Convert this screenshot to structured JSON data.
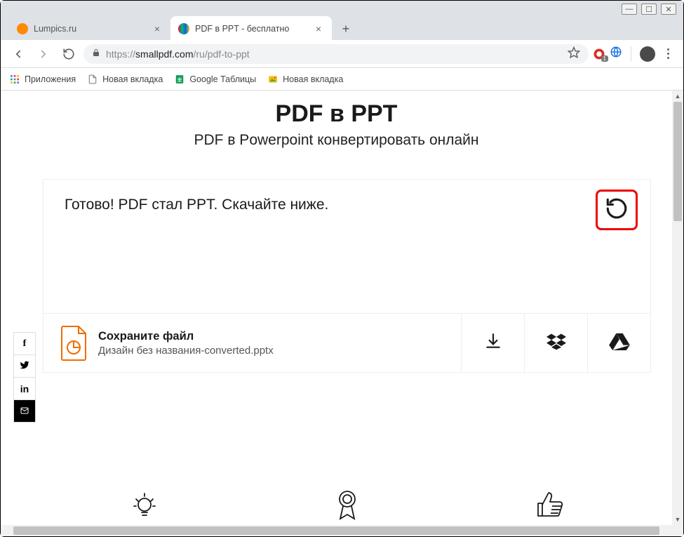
{
  "browser": {
    "tabs": [
      {
        "label": "Lumpics.ru",
        "favicon_color": "#ff8a00",
        "active": false
      },
      {
        "label": "PDF в PPT - бесплатно",
        "favicon_stripes": true,
        "active": true
      }
    ],
    "url": {
      "scheme": "https://",
      "host": "smallpdf.com",
      "path": "/ru/pdf-to-ppt"
    },
    "ext_block_count": "1",
    "bookmarks": [
      {
        "label": "Приложения",
        "kind": "apps"
      },
      {
        "label": "Новая вкладка",
        "kind": "page"
      },
      {
        "label": "Google Таблицы",
        "kind": "sheets"
      },
      {
        "label": "Новая вкладка",
        "kind": "pic"
      }
    ]
  },
  "page": {
    "title": "PDF в PPT",
    "subtitle": "PDF в Powerpoint конвертировать онлайн",
    "status": "Готово! PDF стал PPT. Скачайте ниже.",
    "save_label": "Сохраните файл",
    "file_name": "Дизайн без названия-converted.pptx",
    "icons": {
      "restart": "restart-icon",
      "download": "download-icon",
      "dropbox": "dropbox-icon",
      "gdrive": "google-drive-icon",
      "file": "ppt-file-icon",
      "bulb": "lightbulb-icon",
      "award": "award-icon",
      "thumbs": "thumbs-up-icon"
    },
    "social": [
      "f",
      "twitter",
      "in",
      "mail"
    ]
  }
}
